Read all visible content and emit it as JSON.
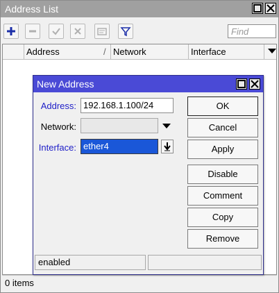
{
  "window": {
    "title": "Address List"
  },
  "toolbar": {
    "find_placeholder": "Find"
  },
  "table": {
    "columns": [
      "Address",
      "Network",
      "Interface"
    ]
  },
  "status": {
    "items": "0 items"
  },
  "dialog": {
    "title": "New Address",
    "fields": {
      "address_label": "Address:",
      "address_value": "192.168.1.100/24",
      "network_label": "Network:",
      "network_value": "",
      "interface_label": "Interface:",
      "interface_value": "ether4"
    },
    "buttons": {
      "ok": "OK",
      "cancel": "Cancel",
      "apply": "Apply",
      "disable": "Disable",
      "comment": "Comment",
      "copy": "Copy",
      "remove": "Remove"
    },
    "status": {
      "state": "enabled",
      "extra": ""
    }
  },
  "colors": {
    "active_title": "#4a4ad6",
    "inactive_title": "#a0a0a0",
    "selection": "#1a57d8",
    "label_blue": "#2020c8"
  }
}
